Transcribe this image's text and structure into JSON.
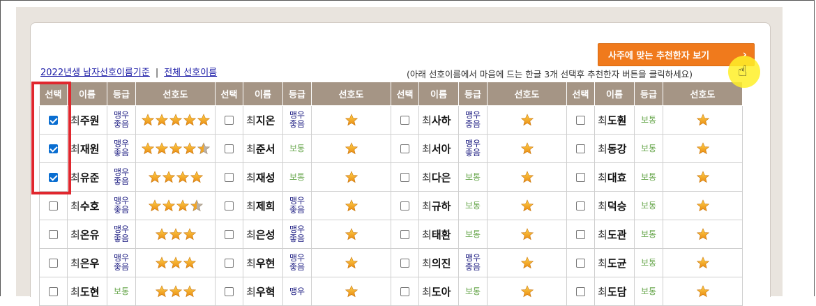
{
  "recommend_button": {
    "label": "사주에 맞는 추천한자 보기",
    "arrow": "›"
  },
  "links": {
    "year_basis": "2022년생 남자선호이름기준",
    "separator": "|",
    "all": "전체 선호이름"
  },
  "hint": "(아래 선호이름에서 마음에 드는 한글 3개 선택후 추천한자 버튼을 클릭하세요)",
  "headers": [
    "선택",
    "이름",
    "등급",
    "선호도"
  ],
  "colors": {
    "header_bg": "#a59585",
    "grade_top": "#1a1a80",
    "grade_normal": "#6aa84f",
    "button": "#f07a1c",
    "highlight": "#e0272e"
  },
  "groups": [
    [
      {
        "checked": true,
        "surname": "최",
        "given": "주원",
        "grade": "맹우\n좋음",
        "stars": 5
      },
      {
        "checked": true,
        "surname": "최",
        "given": "재원",
        "grade": "맹우\n좋음",
        "stars": 4.5
      },
      {
        "checked": true,
        "surname": "최",
        "given": "유준",
        "grade": "맹우\n좋음",
        "stars": 4
      },
      {
        "checked": false,
        "surname": "최",
        "given": "수호",
        "grade": "맹우\n좋음",
        "stars": 3.5
      },
      {
        "checked": false,
        "surname": "최",
        "given": "온유",
        "grade": "맹우\n좋음",
        "stars": 3
      },
      {
        "checked": false,
        "surname": "최",
        "given": "은우",
        "grade": "맹우\n좋음",
        "stars": 3
      },
      {
        "checked": false,
        "surname": "최",
        "given": "도현",
        "grade": "보통",
        "stars": 3
      }
    ],
    [
      {
        "checked": false,
        "surname": "최",
        "given": "지온",
        "grade": "맹우\n좋음",
        "stars": 1
      },
      {
        "checked": false,
        "surname": "최",
        "given": "준서",
        "grade": "보통",
        "stars": 1
      },
      {
        "checked": false,
        "surname": "최",
        "given": "재성",
        "grade": "보통",
        "stars": 1
      },
      {
        "checked": false,
        "surname": "최",
        "given": "제희",
        "grade": "맹우\n좋음",
        "stars": 1
      },
      {
        "checked": false,
        "surname": "최",
        "given": "은성",
        "grade": "맹우\n좋음",
        "stars": 1
      },
      {
        "checked": false,
        "surname": "최",
        "given": "우현",
        "grade": "맹우\n좋음",
        "stars": 1
      },
      {
        "checked": false,
        "surname": "최",
        "given": "우혁",
        "grade": "맹우",
        "stars": 1
      }
    ],
    [
      {
        "checked": false,
        "surname": "최",
        "given": "사하",
        "grade": "맹우\n좋음",
        "stars": 1
      },
      {
        "checked": false,
        "surname": "최",
        "given": "서아",
        "grade": "맹우\n좋음",
        "stars": 1
      },
      {
        "checked": false,
        "surname": "최",
        "given": "다은",
        "grade": "보통",
        "stars": 1
      },
      {
        "checked": false,
        "surname": "최",
        "given": "규하",
        "grade": "보통",
        "stars": 1
      },
      {
        "checked": false,
        "surname": "최",
        "given": "태환",
        "grade": "보통",
        "stars": 1
      },
      {
        "checked": false,
        "surname": "최",
        "given": "의진",
        "grade": "맹우\n좋음",
        "stars": 1
      },
      {
        "checked": false,
        "surname": "최",
        "given": "도아",
        "grade": "보통",
        "stars": 1
      }
    ],
    [
      {
        "checked": false,
        "surname": "최",
        "given": "도훤",
        "grade": "보통",
        "stars": 1
      },
      {
        "checked": false,
        "surname": "최",
        "given": "동강",
        "grade": "보통",
        "stars": 1
      },
      {
        "checked": false,
        "surname": "최",
        "given": "대효",
        "grade": "보통",
        "stars": 1
      },
      {
        "checked": false,
        "surname": "최",
        "given": "덕승",
        "grade": "보통",
        "stars": 1
      },
      {
        "checked": false,
        "surname": "최",
        "given": "도관",
        "grade": "보통",
        "stars": 1
      },
      {
        "checked": false,
        "surname": "최",
        "given": "도균",
        "grade": "보통",
        "stars": 1
      },
      {
        "checked": false,
        "surname": "최",
        "given": "도담",
        "grade": "보통",
        "stars": 1
      }
    ]
  ]
}
